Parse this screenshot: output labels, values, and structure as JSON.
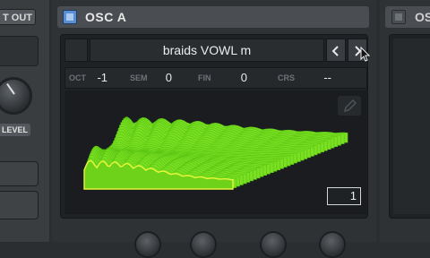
{
  "left_panel": {
    "out_button_label": "T OUT",
    "level_label": "LEVEL"
  },
  "osc_a": {
    "title": "OSC A",
    "wavetable": {
      "name": "braids VOWL m",
      "prev_icon": "chevron-left-icon",
      "next_icon": "chevron-right-icon"
    },
    "params": [
      {
        "label": "OCT",
        "value": "-1"
      },
      {
        "label": "SEM",
        "value": "0"
      },
      {
        "label": "FIN",
        "value": "0"
      },
      {
        "label": "CRS",
        "value": "--"
      }
    ],
    "edit_icon": "pencil-icon",
    "frame": "1"
  },
  "right_panel": {
    "title": "OSC"
  },
  "colors": {
    "accent_blue": "#5a8ed1",
    "waveform_green": "#7be022",
    "waveform_front": "#e8f53a",
    "panel_bg": "#2f3235"
  }
}
